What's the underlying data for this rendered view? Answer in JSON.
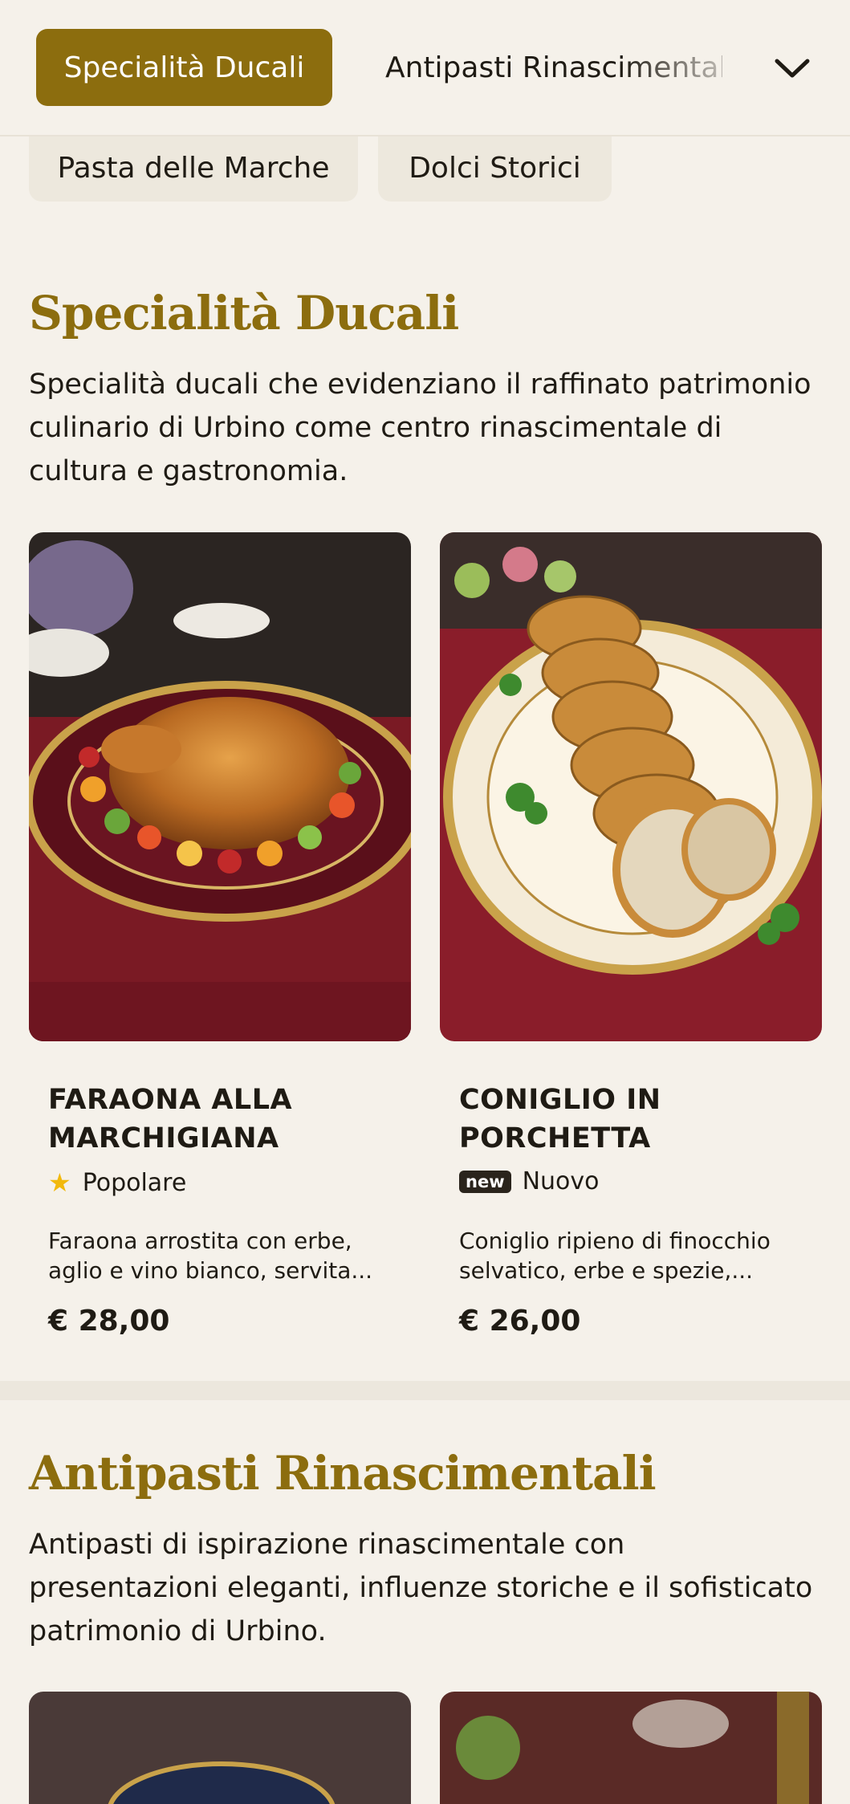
{
  "nav": {
    "active_tab": "Specialità Ducali",
    "next_tab": "Antipasti Rinascimentali",
    "more_tabs": [
      "Pasta delle Marche",
      "Dolci Storici"
    ],
    "expand_icon": "chevron-down-icon"
  },
  "sections": [
    {
      "title": "Specialità Ducali",
      "description": "Specialità ducali che evidenziano il raffinato patrimonio culinario di Urbino come centro rinascimentale di cultura e gastronomia.",
      "dishes": [
        {
          "name": "FARAONA ALLA MARCHIGIANA",
          "tag": "Popolare",
          "tag_icon": "star-icon",
          "description": "Faraona arrostita con erbe, aglio e vino bianco, servita...",
          "price": "€ 28,00"
        },
        {
          "name": "CONIGLIO IN PORCHETTA",
          "tag": "Nuovo",
          "tag_badge": "new",
          "description": "Coniglio ripieno di finocchio selvatico, erbe e spezie,...",
          "price": "€ 26,00"
        }
      ]
    },
    {
      "title": "Antipasti Rinascimentali",
      "description": "Antipasti di ispirazione rinascimentale con presentazioni eleganti, influenze storiche e il sofisticato patrimonio di Urbino."
    }
  ],
  "colors": {
    "accent": "#8c6d0e",
    "background": "#f5f1ea",
    "text": "#1f1b14",
    "star": "#f2b90c"
  }
}
